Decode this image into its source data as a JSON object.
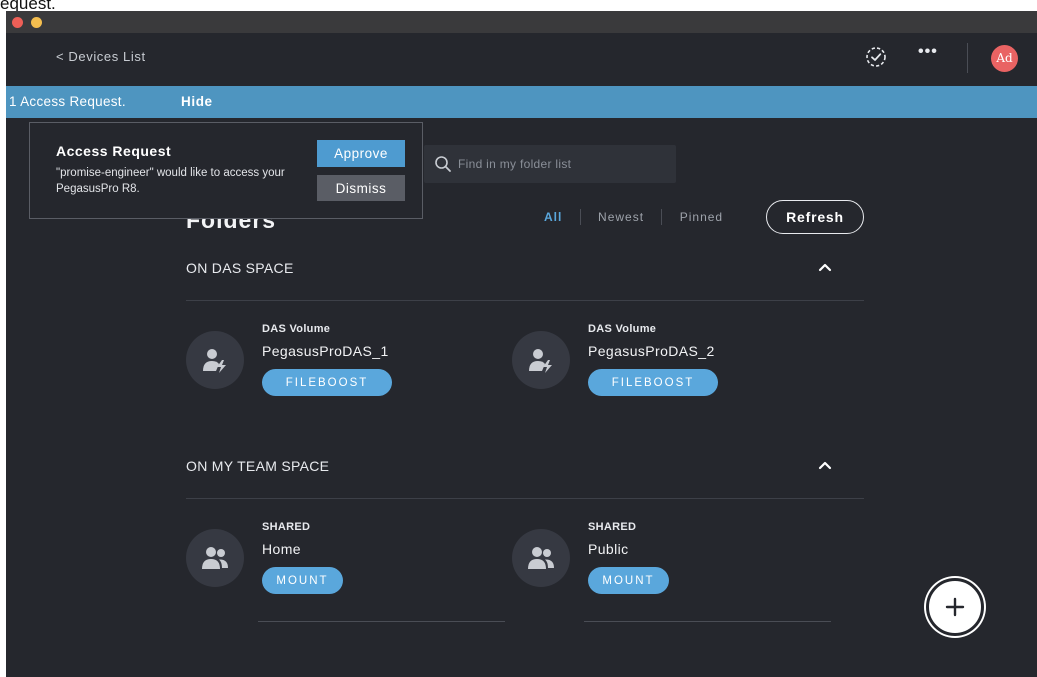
{
  "caption": "equest.",
  "header": {
    "back_label": "< Devices List",
    "avatar_initials": "Ad",
    "icons": [
      "status-check-icon",
      "more-icon"
    ]
  },
  "notice": {
    "text": "1 Access Request.",
    "hide_label": "Hide"
  },
  "access_request": {
    "title": "Access Request",
    "message": "\"promise-engineer\" would like to access your PegasusPro R8.",
    "approve_label": "Approve",
    "dismiss_label": "Dismiss"
  },
  "search": {
    "placeholder": "Find in my folder list"
  },
  "main": {
    "title": "Folders",
    "filters": [
      "All",
      "Newest",
      "Pinned"
    ],
    "active_filter": "All",
    "refresh_label": "Refresh"
  },
  "sections": [
    {
      "title": "ON DAS SPACE",
      "items": [
        {
          "kicker": "DAS Volume",
          "name": "PegasusProDAS_1",
          "action": "FILEBOOST",
          "icon": "user-bolt-icon"
        },
        {
          "kicker": "DAS Volume",
          "name": "PegasusProDAS_2",
          "action": "FILEBOOST",
          "icon": "user-bolt-icon"
        }
      ]
    },
    {
      "title": "ON MY TEAM SPACE",
      "items": [
        {
          "kicker": "SHARED",
          "name": "Home",
          "action": "MOUNT",
          "icon": "group-icon"
        },
        {
          "kicker": "SHARED",
          "name": "Public",
          "action": "MOUNT",
          "icon": "group-icon"
        }
      ]
    }
  ],
  "fab": {
    "icon": "plus-icon"
  },
  "colors": {
    "background": "#25272d",
    "accent": "#5aa7dc",
    "notice_bar": "#4e95c0",
    "avatar": "#e96363"
  }
}
